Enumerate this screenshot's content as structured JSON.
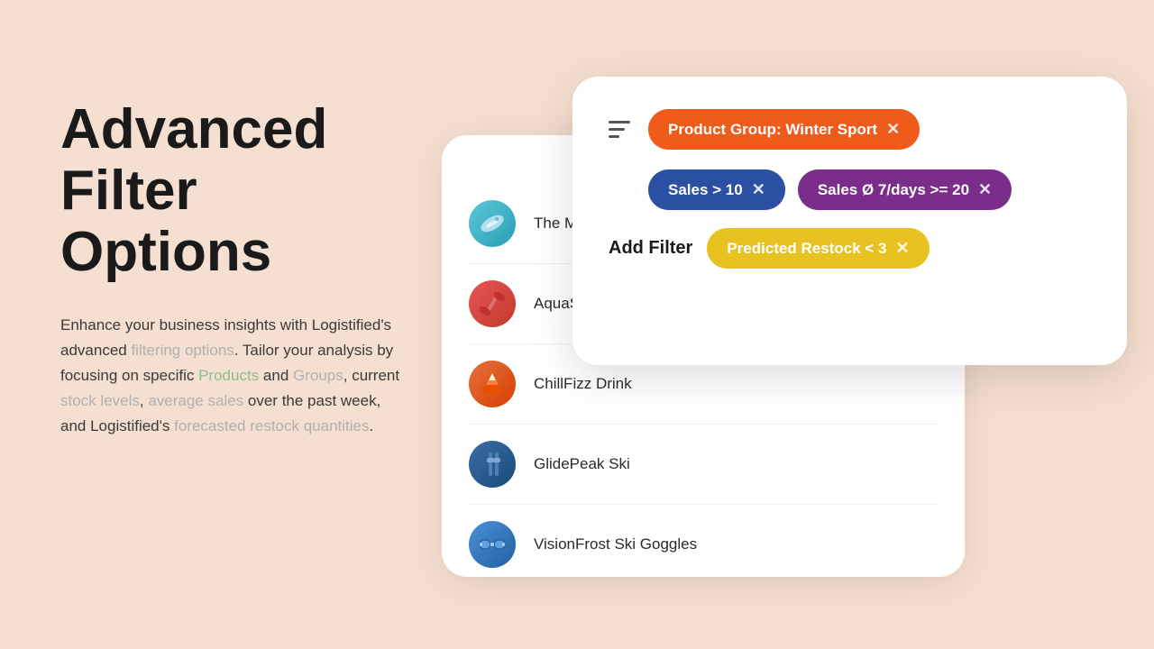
{
  "page": {
    "background_color": "#f5dfd0"
  },
  "left": {
    "title_line1": "Advanced",
    "title_line2": "Filter",
    "title_line3": "Options",
    "description_parts": [
      {
        "text": "Enhance your business insights with Logistified's advanced ",
        "type": "normal"
      },
      {
        "text": "filtering options",
        "type": "link-gray"
      },
      {
        "text": ". Tailor your analysis by focusing on specific ",
        "type": "normal"
      },
      {
        "text": "Products",
        "type": "link-green"
      },
      {
        "text": " and ",
        "type": "normal"
      },
      {
        "text": "Groups",
        "type": "link-gray"
      },
      {
        "text": ", current ",
        "type": "normal"
      },
      {
        "text": "stock levels",
        "type": "link-gray"
      },
      {
        "text": ", ",
        "type": "normal"
      },
      {
        "text": "average sales",
        "type": "link-gray"
      },
      {
        "text": " over the past week, and Logistified's ",
        "type": "normal"
      },
      {
        "text": "forecasted restock quantities",
        "type": "link-gray"
      },
      {
        "text": ".",
        "type": "normal"
      }
    ]
  },
  "filter_card": {
    "tags_row1": [
      {
        "id": "tag-winter",
        "label": "Product Group: Winter Sport",
        "color": "orange",
        "close": "×"
      },
      {
        "id": "tag-sales10",
        "label": "Sales > 10",
        "color": "blue",
        "close": "×"
      },
      {
        "id": "tag-sales20",
        "label": "Sales Ø 7/days >= 20",
        "color": "purple",
        "close": "×"
      }
    ],
    "add_filter_label": "Add Filter",
    "tags_row2": [
      {
        "id": "tag-restock",
        "label": "Predicted Restock < 3",
        "color": "yellow",
        "close": "×"
      }
    ]
  },
  "product_list": {
    "items": [
      {
        "id": "item-1",
        "name": "The Min…",
        "icon_type": "mint"
      },
      {
        "id": "item-2",
        "name": "AquaSprin…",
        "icon_type": "aqua"
      },
      {
        "id": "item-3",
        "name": "ChillFizz Drink",
        "icon_type": "chill"
      },
      {
        "id": "item-4",
        "name": "GlidePeak Ski",
        "icon_type": "glide"
      },
      {
        "id": "item-5",
        "name": "VisionFrost Ski Goggles",
        "icon_type": "vision"
      }
    ]
  }
}
